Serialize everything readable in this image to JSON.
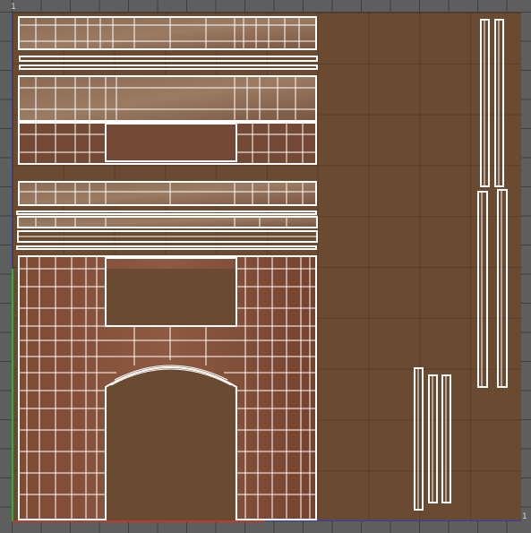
{
  "uv_editor": {
    "corner_label_top": "1",
    "corner_label_right": "1"
  },
  "colors": {
    "background": "#5e5e5e",
    "texture": "#6b4a32",
    "wire": "#ffffff",
    "u_axis": "#c0392b",
    "v_axis": "#27b03a",
    "bounds": "#2740c8"
  }
}
